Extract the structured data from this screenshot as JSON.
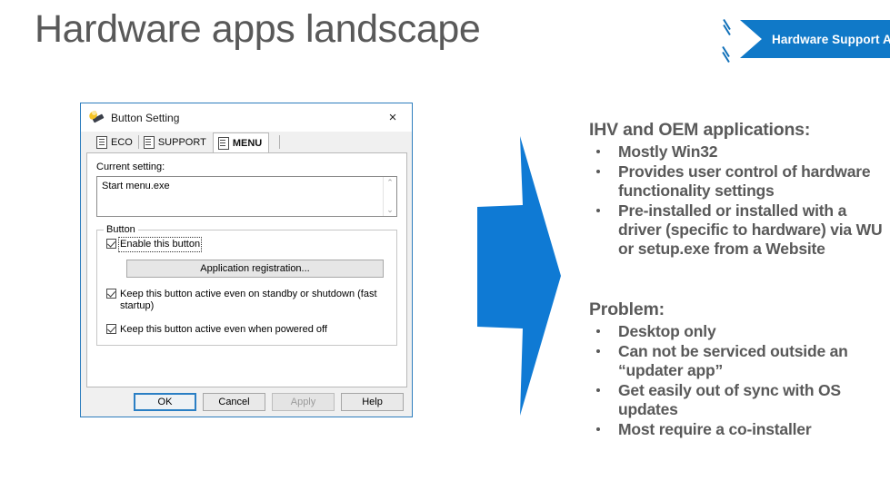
{
  "slide": {
    "title": "Hardware apps landscape",
    "title_color": "#595959",
    "accent_color": "#1079c8"
  },
  "badge": {
    "label": "Hardware Support Apps",
    "color": "#1079c8"
  },
  "arrow": {
    "name": "right-arrow",
    "color": "#0f7ad4"
  },
  "dialog": {
    "title": "Button Setting",
    "icon": "paintbrush-icon",
    "close_label": "×",
    "tabs": [
      {
        "label": "ECO",
        "active": false
      },
      {
        "label": "SUPPORT",
        "active": false
      },
      {
        "label": "MENU",
        "active": true
      }
    ],
    "current_setting": {
      "label": "Current setting:",
      "value": "Start menu.exe",
      "scroll_up": "⌃",
      "scroll_down": "⌄"
    },
    "button_group": {
      "title": "Button",
      "enable_checkbox": "Enable this button",
      "enable_checked": true,
      "app_registration_button": "Application registration..."
    },
    "options": [
      {
        "label": "Keep this button active even on standby or shutdown (fast startup)",
        "checked": true
      },
      {
        "label": "Keep this button active even when powered off",
        "checked": true
      }
    ],
    "footer_buttons": [
      {
        "label": "OK",
        "state": "default"
      },
      {
        "label": "Cancel",
        "state": "normal"
      },
      {
        "label": "Apply",
        "state": "disabled"
      },
      {
        "label": "Help",
        "state": "normal"
      }
    ]
  },
  "content": {
    "ihv": {
      "heading": "IHV and OEM applications:",
      "items": [
        "Mostly Win32",
        "Provides user control of hardware functionality settings",
        "Pre-installed or installed with a driver (specific to hardware) via WU or setup.exe from a Website"
      ]
    },
    "problem": {
      "heading": "Problem:",
      "items": [
        "Desktop only",
        "Can not be serviced outside an “updater app”",
        "Get easily out of sync with OS updates",
        "Most require a co-installer"
      ]
    }
  }
}
